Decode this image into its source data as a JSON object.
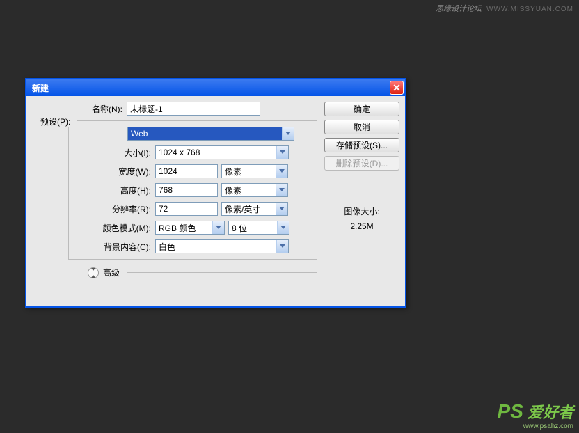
{
  "watermark_top": {
    "text": "思缘设计论坛",
    "url": "WWW.MISSYUAN.COM"
  },
  "watermark_bottom": {
    "ps": "PS",
    "text": " 爱好者",
    "url": "www.psahz.com"
  },
  "dialog": {
    "title": "新建",
    "name_label": "名称(N):",
    "name_value": "未标题-1",
    "preset_label": "预设(P):",
    "preset_value": "Web",
    "size_label": "大小(I):",
    "size_value": "1024 x 768",
    "width_label": "宽度(W):",
    "width_value": "1024",
    "width_unit": "像素",
    "height_label": "高度(H):",
    "height_value": "768",
    "height_unit": "像素",
    "resolution_label": "分辨率(R):",
    "resolution_value": "72",
    "resolution_unit": "像素/英寸",
    "colormode_label": "颜色模式(M):",
    "colormode_value": "RGB 颜色",
    "bits_value": "8 位",
    "background_label": "背景内容(C):",
    "background_value": "白色",
    "advanced_label": "高级",
    "image_size_label": "图像大小:",
    "image_size_value": "2.25M",
    "buttons": {
      "ok": "确定",
      "cancel": "取消",
      "save_preset": "存储预设(S)...",
      "delete_preset": "删除预设(D)..."
    }
  }
}
